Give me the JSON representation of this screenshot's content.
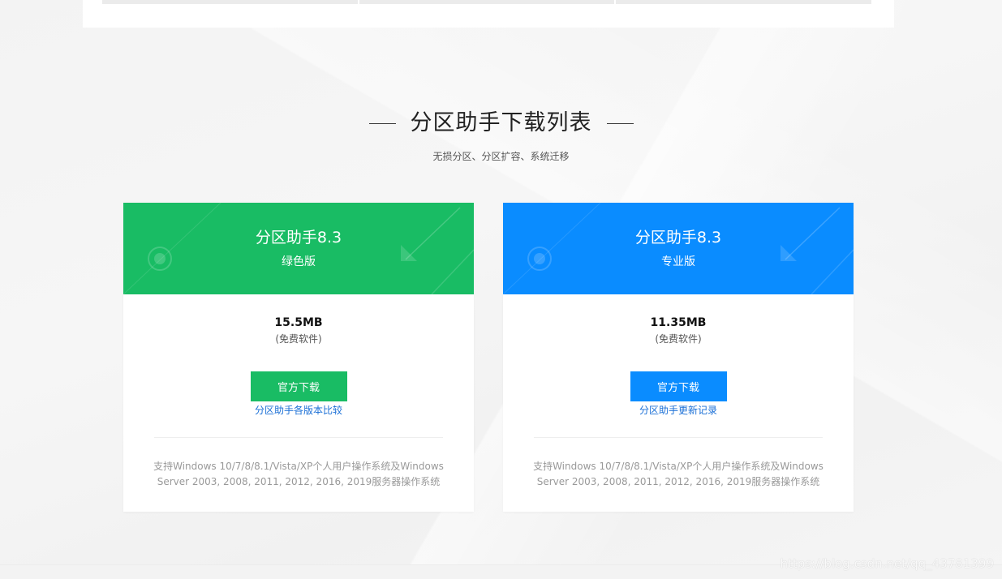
{
  "section": {
    "title": "分区助手下载列表",
    "subtitle": "无损分区、分区扩容、系统迁移"
  },
  "cards": [
    {
      "title": "分区助手8.3",
      "edition": "绿色版",
      "size": "15.5MB",
      "license": "(免费软件)",
      "button_label": "官方下载",
      "link_label": "分区助手各版本比较",
      "support_text": "支持Windows 10/7/8/8.1/Vista/XP个人用户操作系统及Windows Server 2003, 2008, 2011, 2012, 2016, 2019服务器操作系统",
      "accent_color": "#19bc64"
    },
    {
      "title": "分区助手8.3",
      "edition": "专业版",
      "size": "11.35MB",
      "license": "(免费软件)",
      "button_label": "官方下载",
      "link_label": "分区助手更新记录",
      "support_text": "支持Windows 10/7/8/8.1/Vista/XP个人用户操作系统及Windows Server 2003, 2008, 2011, 2012, 2016, 2019服务器操作系统",
      "accent_color": "#0a8cff"
    }
  ],
  "watermark": "https://blog.csdn.net/qq_43781399"
}
